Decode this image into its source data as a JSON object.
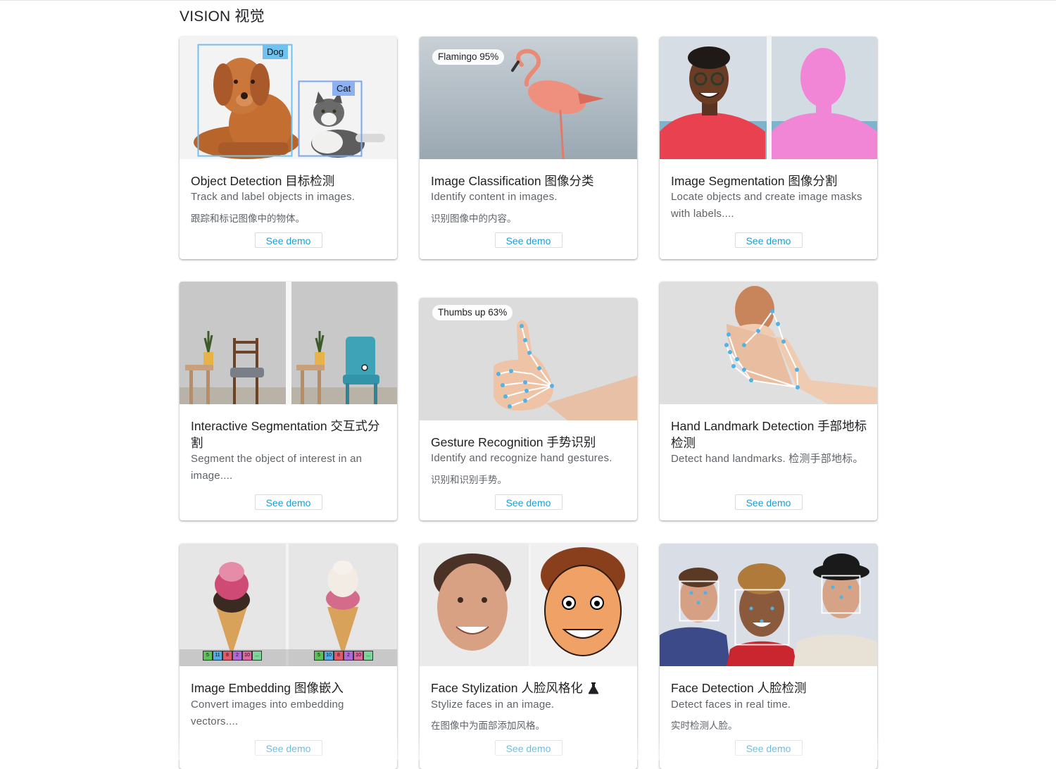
{
  "section": {
    "title": "VISION  视觉"
  },
  "cards": [
    {
      "title": "Object Detection  目标检测",
      "desc": "Track and label objects in images.",
      "desc_zh": "跟踪和标记图像中的物体。",
      "button": "See demo",
      "tags": [
        "Dog",
        "Cat"
      ]
    },
    {
      "title": "Image Classification  图像分类",
      "desc": "Identify content in images.",
      "desc_zh": "识别图像中的内容。",
      "button": "See demo",
      "chip": "Flamingo 95%"
    },
    {
      "title": "Image Segmentation  图像分割",
      "desc": "Locate objects and create image masks with labels....",
      "button": "See demo"
    },
    {
      "title": "Interactive Segmentation  交互式分割",
      "desc": "Segment the object of interest in an image....",
      "button": "See demo"
    },
    {
      "title": "Gesture Recognition  手势识别",
      "desc": "Identify and recognize hand gestures.",
      "desc_zh": "识别和识别手势。",
      "button": "See demo",
      "chip": "Thumbs up 63%"
    },
    {
      "title": "Hand Landmark Detection  手部地标检测",
      "desc": "Detect hand landmarks.  检测手部地标。",
      "button": "See demo"
    },
    {
      "title": "Image Embedding  图像嵌入",
      "desc": "Convert images into embedding vectors....",
      "button": "See demo",
      "vec_left": [
        "5",
        "11",
        "8",
        "2",
        "10",
        "..."
      ],
      "vec_right": [
        "5",
        "10",
        "8",
        "2",
        "10",
        "..."
      ]
    },
    {
      "title": "Face Stylization  人脸风格化",
      "desc": "Stylize faces in an image.",
      "desc_zh": "在图像中为面部添加风格。",
      "button": "See demo",
      "badge_icon": "flask-icon"
    },
    {
      "title": "Face Detection  人脸检测",
      "desc": "Detect faces in real time.",
      "desc_zh": "实时检测人脸。",
      "button": "See demo"
    }
  ],
  "colors": {
    "accent": "#1a9fd0",
    "box": "#6fc2ef",
    "mask": "#f186d6",
    "landmark": "#4fb3e8"
  }
}
